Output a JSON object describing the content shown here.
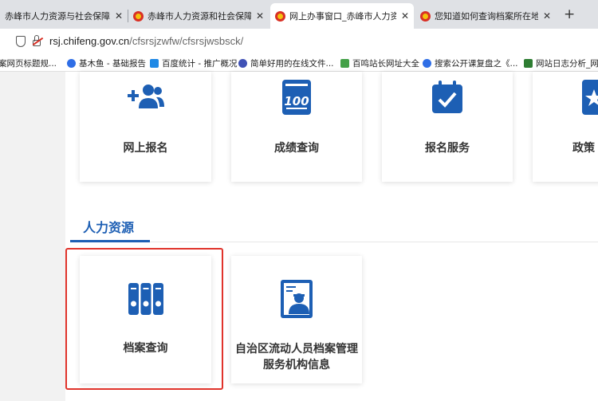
{
  "browser": {
    "tabs": [
      {
        "title": "赤峰市人力资源与社会保障局_i",
        "close": "✕",
        "active": false
      },
      {
        "title": "赤峰市人力资源和社会保障局",
        "close": "✕",
        "active": false
      },
      {
        "title": "网上办事窗口_赤峰市人力资源",
        "close": "✕",
        "active": true
      },
      {
        "title": "您知道如何查询档案所在地，档",
        "close": "✕",
        "active": false
      }
    ],
    "new_tab": "+",
    "url_host": "rsj.chifeng.gov.cn",
    "url_path": "/cfsrsjzwfw/cfsrsjwsbsck/",
    "bookmarks": [
      {
        "label": "案网页标题规...",
        "icon": "none"
      },
      {
        "label": "基木鱼 - 基础报告",
        "icon": "baidu-icon"
      },
      {
        "label": "百度统计 - 推广概况",
        "icon": "stats-icon"
      },
      {
        "label": "简单好用的在线文件...",
        "icon": "c-icon"
      },
      {
        "label": "百鸣站长网址大全",
        "icon": "green-icon"
      },
      {
        "label": "搜索公开课复盘之《...",
        "icon": "paw-icon"
      },
      {
        "label": "网站日志分析_网站",
        "icon": "cube-icon"
      }
    ]
  },
  "page": {
    "top_cards": [
      {
        "label": "网上报名",
        "icon": "add-users-icon"
      },
      {
        "label": "成绩查询",
        "icon": "score-100-icon"
      },
      {
        "label": "报名服务",
        "icon": "calendar-check-icon"
      },
      {
        "label": "政策",
        "icon": "policy-icon"
      }
    ],
    "section_title": "人力资源",
    "hr_cards": [
      {
        "label": "档案查询",
        "icon": "binders-icon"
      },
      {
        "label_line1": "自治区流动人员档案管理",
        "label_line2": "服务机构信息",
        "icon": "id-card-icon"
      }
    ]
  },
  "colors": {
    "brand_blue": "#1d5fb4",
    "highlight_red": "#e0332b"
  }
}
